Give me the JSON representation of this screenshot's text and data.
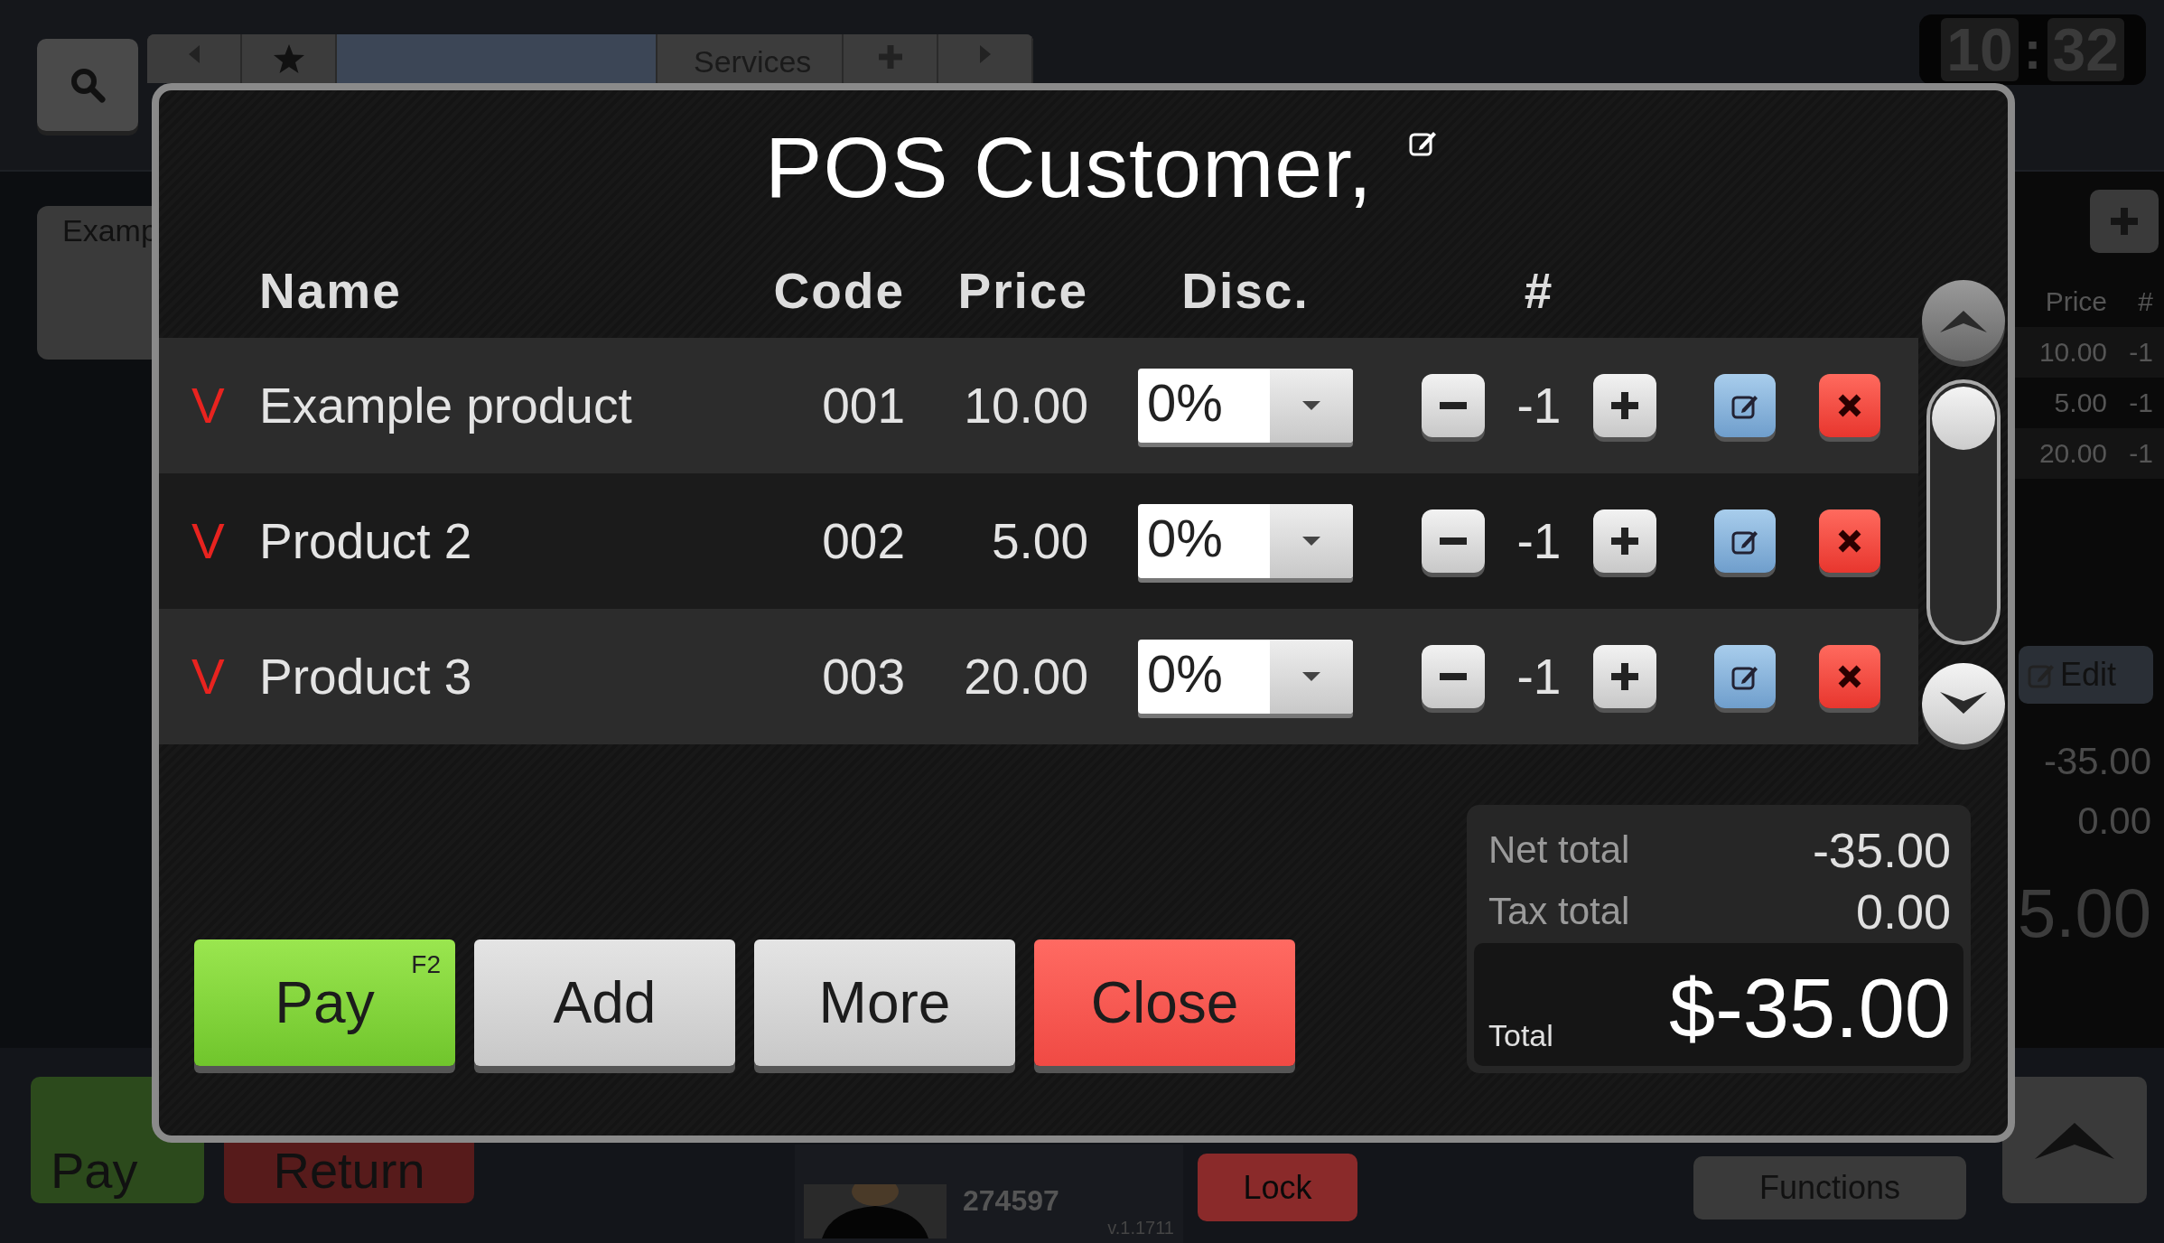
{
  "top_bar": {
    "tabs": [
      {
        "selected": true
      },
      {
        "label": "Services",
        "selected": false
      }
    ],
    "clock": {
      "hours": "10",
      "separator": ":",
      "minutes": "32"
    }
  },
  "left_panel": {
    "card_title": "Examp"
  },
  "right_panel": {
    "columns": [
      "Price",
      "#"
    ],
    "rows": [
      {
        "price": "10.00",
        "qty": "-1"
      },
      {
        "price": "5.00",
        "qty": "-1"
      },
      {
        "price": "20.00",
        "qty": "-1"
      }
    ],
    "edit_button": "Edit",
    "net": "-35.00",
    "tax": "0.00",
    "total": "5.00"
  },
  "bottom_bar": {
    "buttons": [
      {
        "label": "Pay",
        "kind": "pay"
      },
      {
        "label": "Return",
        "kind": "return"
      }
    ],
    "user": {
      "id": "274597",
      "version": "v.1.1711"
    },
    "lock": "Lock",
    "functions": "Functions"
  },
  "dialog": {
    "title": "POS Customer,",
    "columns": [
      "Name",
      "Code",
      "Price",
      "Disc.",
      "#"
    ],
    "rows": [
      {
        "mark": "V",
        "name": "Example product",
        "code": "001",
        "price": "10.00",
        "discount": "0%",
        "qty": "-1"
      },
      {
        "mark": "V",
        "name": "Product 2",
        "code": "002",
        "price": "5.00",
        "discount": "0%",
        "qty": "-1"
      },
      {
        "mark": "V",
        "name": "Product 3",
        "code": "003",
        "price": "20.00",
        "discount": "0%",
        "qty": "-1"
      }
    ],
    "totals": {
      "net_label": "Net total",
      "net": "-35.00",
      "tax_label": "Tax total",
      "tax": "0.00",
      "total_label": "Total",
      "total": "$-35.00"
    },
    "buttons": [
      {
        "label": "Pay",
        "shortcut": "F2",
        "kind": "pay"
      },
      {
        "label": "Add",
        "kind": "plain"
      },
      {
        "label": "More",
        "kind": "plain"
      },
      {
        "label": "Close",
        "kind": "close"
      }
    ]
  }
}
